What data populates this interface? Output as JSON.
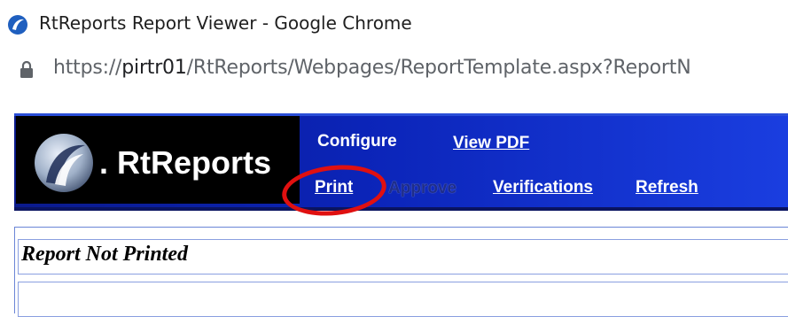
{
  "browser": {
    "window_title": "RtReports Report Viewer - Google Chrome",
    "url_prefix": "https://",
    "url_host": "pirtr01",
    "url_path": "/RtReports/Webpages/ReportTemplate.aspx?ReportN"
  },
  "header": {
    "logo_text": ". RtReports",
    "nav": {
      "configure": "Configure",
      "view_pdf": "View PDF",
      "print": "Print",
      "approve": "Approve",
      "verifications": "Verifications",
      "refresh": "Refresh"
    },
    "approve_state": "disabled",
    "highlighted_item": "print"
  },
  "content": {
    "status_text": "Report Not Printed"
  },
  "icons": {
    "favicon": "rtreports-favicon-icon",
    "lock": "lock-icon",
    "logo": "rtreports-logo-icon"
  },
  "colors": {
    "header_blue": "#0b24b8",
    "annotation_red": "#e01010",
    "logo_bg": "#000000"
  }
}
